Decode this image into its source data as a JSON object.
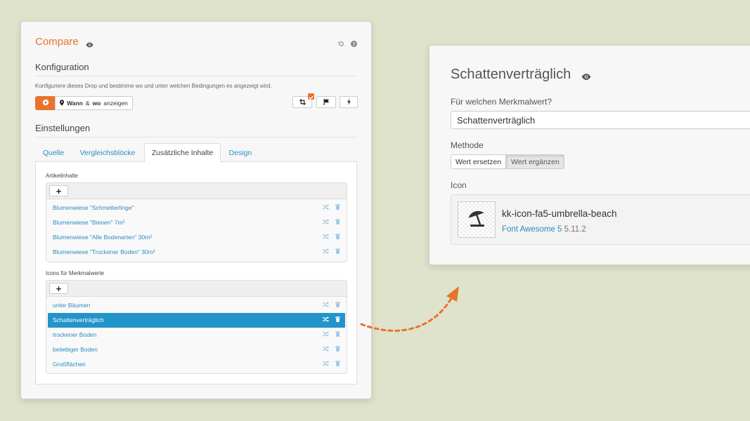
{
  "left_panel": {
    "title": "Compare",
    "konfiguration": {
      "heading": "Konfiguration",
      "description": "Konfiguriere dieses Drop und bestimme wo und unter welchen Bedingungen es angezeigt wird.",
      "when_button_bold": "Wann",
      "when_button_amp": "&",
      "when_button_bold2": "wo",
      "when_button_rest": "anzeigen"
    },
    "einstellungen": {
      "heading": "Einstellungen",
      "tabs": [
        {
          "label": "Quelle"
        },
        {
          "label": "Vergleichsblöcke"
        },
        {
          "label": "Zusätzliche Inhalte",
          "active": true
        },
        {
          "label": "Design"
        }
      ],
      "artikelinhalte": {
        "label": "Artikelinhalte",
        "items": [
          "Blumenwiese \"Schmetterlinge\"",
          "Blumenwiese \"Bienen\" 7m²",
          "Blumenwiese \"Alle Bodenarten\" 30m²",
          "Blumenwiese \"Trockener Boden\" 30m²"
        ]
      },
      "icons": {
        "label": "Icons für Merkmalwerte",
        "items": [
          "unter Bäumen",
          "Schattenverträglich",
          "trockener Boden",
          "beliebiger Boden",
          "Großflächen"
        ],
        "selected": "Schattenverträglich"
      }
    }
  },
  "right_panel": {
    "title": "Schattenverträglich",
    "field_label": "Für welchen Merkmalwert?",
    "field_value": "Schattenverträglich",
    "method_label": "Methode",
    "method_options": [
      "Wert ersetzen",
      "Wert ergänzen"
    ],
    "method_selected": "Wert ergänzen",
    "icon_label": "Icon",
    "icon_name": "kk-icon-fa5-umbrella-beach",
    "icon_library": "Font Awesome 5",
    "icon_version": "5.11.2"
  },
  "colors": {
    "background": "#dfe3cb",
    "accent": "#e8732c",
    "link": "#2d8cc0",
    "selected_row": "#2394c9"
  }
}
